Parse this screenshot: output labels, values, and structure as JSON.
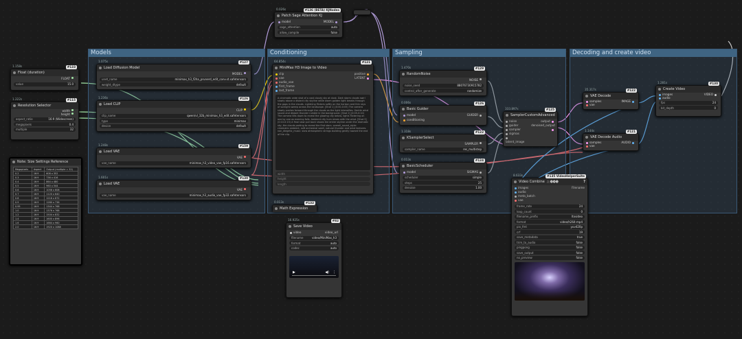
{
  "groups": {
    "models": "Models",
    "conditioning": "Conditioning",
    "sampling": "Sampling",
    "decoding": "Decoding and create video"
  },
  "float_node": {
    "time": "1.158s",
    "title": "Float (duration)",
    "badge": "#133",
    "out": "FLOAT",
    "w_label": "value",
    "w_val": "15.0"
  },
  "res_node": {
    "time": "1.222s",
    "title": "Resolution Selector",
    "badge": "#115",
    "out1": "width",
    "out2": "height",
    "w1_label": "aspect_ratio",
    "w1_val": "16:9 (Widescreen)",
    "w2_label": "megapixels",
    "w2_val": "0.4",
    "w3_label": "multiple",
    "w3_val": "32"
  },
  "note": {
    "title": "Note: Size Settings Reference",
    "headers": [
      "Megapixels",
      "Aspect",
      "Output (multiple = 32)"
    ],
    "rows": [
      [
        "0.2",
        "16:9",
        "608 x 352"
      ],
      [
        "0.3",
        "16:9",
        "736 x 416"
      ],
      [
        "0.4",
        "16:9",
        "864 x 480"
      ],
      [
        "0.5",
        "16:9",
        "960 x 544"
      ],
      [
        "0.6",
        "16:9",
        "1056 x 608"
      ],
      [
        "0.7",
        "16:9",
        "1120 x 640"
      ],
      [
        "0.8",
        "16:9",
        "1216 x 672"
      ],
      [
        "0.9",
        "16:9",
        "1280 x 736"
      ],
      [
        "0.95",
        "16:9",
        "1344 x 768"
      ],
      [
        "1.0",
        "16:9",
        "1376 x 768"
      ],
      [
        "1.2",
        "16:9",
        "1504 x 832"
      ],
      [
        "1.4",
        "16:9",
        "1600 x 896"
      ],
      [
        "1.6",
        "16:9",
        "1664 x 960"
      ],
      [
        "2.0",
        "16:9",
        "1920 x 1088"
      ]
    ]
  },
  "sage": {
    "time": "0.026s",
    "title": "Patch Sage Attention KJ",
    "badge": "#136 (BETA) KJNodes",
    "in": "model",
    "out": "MODEL",
    "w1_label": "sage_attention",
    "w1_val": "auto",
    "w2_label": "allow_compile",
    "w2_val": "false"
  },
  "load_diff": {
    "time": "1.075s",
    "title": "Load Diffusion Model",
    "badge": "#127",
    "out": "MODEL",
    "w1_label": "unet_name",
    "w1_val": "minimax_h3_f2ha_prunerd_edit_conv.st.safetensors",
    "w2_label": "weight_dtype",
    "w2_val": "default"
  },
  "load_clip": {
    "time": "1.236s",
    "title": "Load CLIP",
    "badge": "#126",
    "out": "CLIP",
    "w1_label": "clip_name",
    "w1_val": "qwen/vl_32b_minimax_h3_edit.safetensors",
    "w2_label": "type",
    "w2_val": "minimax",
    "w3_label": "device",
    "w3_val": "default"
  },
  "load_vae1": {
    "time": "1.248s",
    "title": "Load VAE",
    "badge": "#159",
    "out": "VAE",
    "w_label": "vae_name",
    "w_val": "minimax_h3_video_vae_fp16.safetensors"
  },
  "load_vae2": {
    "time": "1.601s",
    "title": "Load VAE",
    "badge": "#130",
    "out": "VAE",
    "w_label": "vae_name",
    "w_val": "minimax_h3_audio_vae_fp32.safetensors"
  },
  "i2v": {
    "time": "64.854s",
    "title": "MiniMax H3 Image to Video",
    "badge": "#121",
    "ins": [
      "clip",
      "vae",
      "audio_vae",
      "first_frame",
      "last_frame"
    ],
    "outs": [
      "positive",
      "LATENT"
    ],
    "prompt": "A cinematic wide shot of a vast cloudy sky at dusk. Dark storm clouds swirl slowly above a distant city skyline while warm golden light breaks through the gaps in the clouds. Lightning flickers softly on the horizon and thin rays of sunlight sweep across the landscape.\n\n[Shot 1] (0:00-0:05) The camera slowly pushes forward through the clouds as the light intensifies. Gentle wind sound and distant thunder rumble in the background.\n\n[Shot 2] (0:05-0:10) The camera tilts down to reveal the glowing city below, lights flickering on one by one as evening falls. Ambient city hum mixes with the wind.\n\n[Shot 3] (0:10-0:15) A final slow pull back shows the entire skyline under the dramatic sky, the clouds parting to reveal the first stars.\n\noverall_sound_style: cinematic ambient, soft orchestral swell, natural thunder and wind textures.\n\nnon_diegetic_music: slow atmospheric strings building gently toward the end of the clip.",
    "w1_label": "width",
    "w2_label": "height",
    "w3_label": "length"
  },
  "math": {
    "time": "0.013s",
    "title": "Math Expression",
    "badge": "#132"
  },
  "save_audio": {
    "time": "16.925s",
    "title": "Save Video",
    "badge": "#82",
    "in": "video",
    "out": "video_url",
    "w1_label": "filename",
    "w1_val": "video/MiniMax_h3",
    "w2_label": "format",
    "w2_val": "auto",
    "w3_label": "codec",
    "w3_val": "auto"
  },
  "noise": {
    "time": "1.470s",
    "title": "RandomNoise",
    "badge": "#129",
    "out": "NOISE",
    "w1_label": "noise_seed",
    "w1_val": "88076730915782",
    "w2_label": "control_after_generate",
    "w2_val": "randomize"
  },
  "guider": {
    "time": "0.006s",
    "title": "Basic Guider",
    "badge": "#126",
    "ins": [
      "model",
      "conditioning"
    ],
    "out": "GUIDER"
  },
  "ksel": {
    "time": "1.318s",
    "title": "KSamplerSelect",
    "badge": "#122",
    "out": "SAMPLER",
    "w_label": "sampler_name",
    "w_val": "res_multistep"
  },
  "sched": {
    "time": "0.013s",
    "title": "BasicScheduler",
    "badge": "#124",
    "in": "model",
    "out": "SIGMAS",
    "w1_label": "scheduler",
    "w1_val": "simple",
    "w2_label": "steps",
    "w2_val": "25",
    "w3_label": "denoise",
    "w3_val": "1.00"
  },
  "sca": {
    "time": "333.897s",
    "title": "SamplerCustomAdvanced",
    "badge": "#125",
    "ins": [
      "noise",
      "guider",
      "sampler",
      "sigmas",
      "latent_image"
    ],
    "outs": [
      "output",
      "denoised_output"
    ]
  },
  "vaedec": {
    "time": "35.317s",
    "title": "VAE Decode",
    "badge": "#122",
    "ins": [
      "samples",
      "vae"
    ],
    "out": "IMAGE"
  },
  "vaedec_audio": {
    "time": "1.144s",
    "title": "VAE Decode Audio",
    "badge": "#121",
    "ins": [
      "samples",
      "vae"
    ],
    "out": "AUDIO"
  },
  "create_video": {
    "time": "1.281s",
    "title": "Create Video",
    "badge": "#130",
    "ins": [
      "images",
      "audio"
    ],
    "out": "VIDEO",
    "w1_label": "fps",
    "w1_val": "24",
    "w2_label": "bit_depth",
    "w2_val": "0"
  },
  "vcombine": {
    "time": "8.633s",
    "title": "Video Combine",
    "badge": "#135 VideoHelperSuite",
    "icons": "🎥🅥🅗🅢",
    "help": "?",
    "filename_hint": "Filename",
    "ins": [
      "images",
      "audio",
      "meta_batch",
      "vae"
    ],
    "widgets": [
      [
        "frame_rate",
        "24"
      ],
      [
        "loop_count",
        "0"
      ],
      [
        "filename_prefix",
        "ltxvideo"
      ],
      [
        "format",
        "video/h264-mp4"
      ],
      [
        "pix_fmt",
        "yuv420p"
      ],
      [
        "crf",
        "19"
      ],
      [
        "save_metadata",
        "true"
      ],
      [
        "trim_to_audio",
        "false"
      ],
      [
        "pingpong",
        "false"
      ],
      [
        "save_output",
        "false"
      ],
      [
        "no_preview",
        "false"
      ]
    ]
  },
  "colors": {
    "group": "#3f6482",
    "node": "#353535",
    "accent": "#e5e5e5"
  }
}
